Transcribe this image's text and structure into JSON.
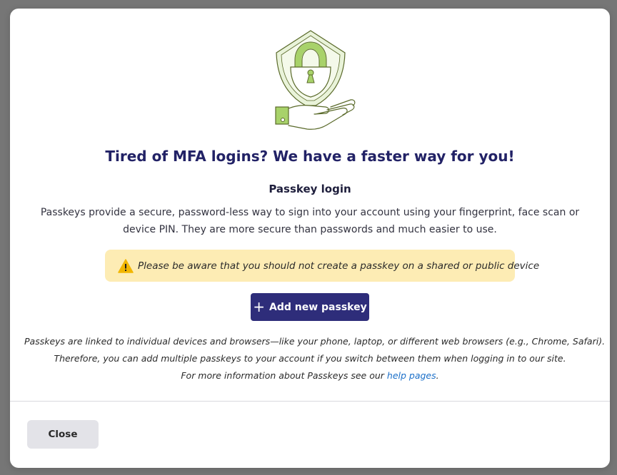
{
  "dialog": {
    "illustration_icon": "shield-lock-hand-icon",
    "title": "Tired of MFA logins? We have a faster way for you!",
    "subtitle": "Passkey login",
    "description": "Passkeys provide a secure, password-less way to sign into your account using your fingerprint, face scan or device PIN. They are more secure than passwords and much easier to use.",
    "warning": {
      "icon": "warning-triangle-icon",
      "text": "Please be aware that you should not create a passkey on a shared or public device"
    },
    "add_button": {
      "icon": "plus-icon",
      "label": "Add new passkey"
    },
    "footnote": {
      "line1": "Passkeys are linked to individual devices and browsers—like your phone, laptop, or different web browsers (e.g., Chrome, Safari).",
      "line2": "Therefore, you can add multiple passkeys to your account if you switch between them when logging in to our site.",
      "line3_prefix": "For more information about Passkeys see our ",
      "link_text": "help pages",
      "line3_suffix": "."
    },
    "close_button": {
      "label": "Close"
    }
  },
  "colors": {
    "backdrop": "#767676",
    "title": "#222266",
    "primary_button": "#2e2d7a",
    "warning_bg": "#fdecb4",
    "link": "#1a6fc9",
    "illustration_green": "#a8d26a",
    "illustration_outline": "#5a6a2a"
  }
}
